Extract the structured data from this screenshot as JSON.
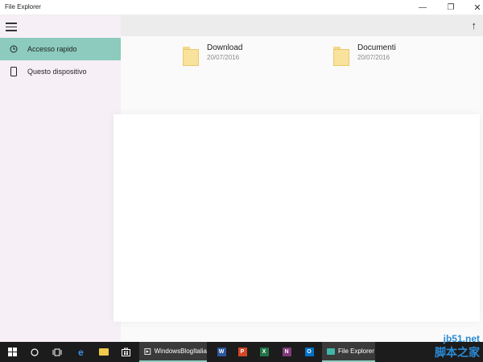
{
  "window": {
    "title": "File Explorer"
  },
  "sidebar": {
    "items": [
      {
        "label": "Accesso rapido",
        "icon": "clock-icon",
        "active": true
      },
      {
        "label": "Questo dispositivo",
        "icon": "device-icon",
        "active": false
      }
    ]
  },
  "files": [
    {
      "name": "Download",
      "date": "20/07/2016"
    },
    {
      "name": "Documenti",
      "date": "20/07/2016"
    }
  ],
  "taskbar": {
    "apps": [
      {
        "label": "WindowsBlogItalia"
      },
      {
        "label": "File Explorer"
      }
    ]
  },
  "watermark": {
    "line1": "jb51.net",
    "line2": "脚本之家"
  },
  "colors": {
    "accent": "#8ccbbd",
    "sidebar_bg": "#f6eff6",
    "taskbar_bg": "#1c1c1c"
  }
}
